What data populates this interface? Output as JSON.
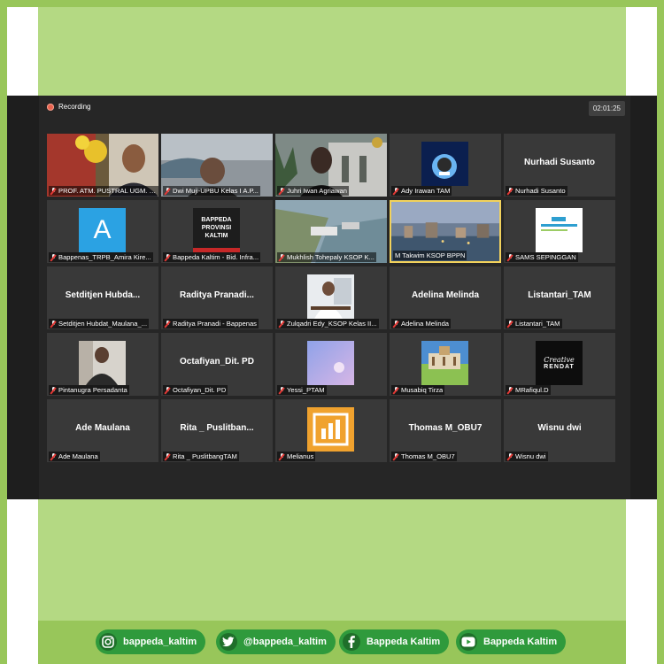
{
  "recording_label": "Recording",
  "timer": "02:01:25",
  "participants": [
    {
      "big_name": "",
      "label": "PROF. ATM. PUSTRAL UGM. M..."
    },
    {
      "big_name": "",
      "label": "Dwi Muji-UPBU Kelas I A.P..."
    },
    {
      "big_name": "",
      "label": "Juhri Iwan Agriawan"
    },
    {
      "big_name": "",
      "label": "Ady Irawan TAM"
    },
    {
      "big_name": "Nurhadi Susanto",
      "label": "Nurhadi Susanto"
    },
    {
      "big_name": "",
      "label": "Bappenas_TRPB_Amira Kire..."
    },
    {
      "big_name": "",
      "label": "Bappeda Kaltim - Bid. Infra..."
    },
    {
      "big_name": "",
      "label": "Mukhlish Tohepaly KSOP K..."
    },
    {
      "big_name": "",
      "label": "M Takwim KSOP BPPN"
    },
    {
      "big_name": "",
      "label": "SAMS SEPINGGAN"
    },
    {
      "big_name": "Setditjen  Hubda...",
      "label": "Setditjen Hubdat_Maulana_..."
    },
    {
      "big_name": "Raditya  Pranadi...",
      "label": "Raditya Pranadi - Bappenas"
    },
    {
      "big_name": "",
      "label": "Zulqadri Edy_KSOP Kelas II..."
    },
    {
      "big_name": "Adelina Melinda",
      "label": "Adelina Melinda"
    },
    {
      "big_name": "Listantari_TAM",
      "label": "Listantari_TAM"
    },
    {
      "big_name": "",
      "label": "Pintanugra Persadanta"
    },
    {
      "big_name": "Octafiyan_Dit. PD",
      "label": "Octafiyan_Dit. PD"
    },
    {
      "big_name": "",
      "label": "Yessi_PTAM"
    },
    {
      "big_name": "",
      "label": "Musabiq Tirza"
    },
    {
      "big_name": "",
      "label": "MRafiqul.D"
    },
    {
      "big_name": "Ade Maulana",
      "label": "Ade Maulana"
    },
    {
      "big_name": "Rita _ Puslitban...",
      "label": "Rita _ PuslitbangTAM"
    },
    {
      "big_name": "",
      "label": "Melianus"
    },
    {
      "big_name": "Thomas M_OBU7",
      "label": "Thomas M_OBU7"
    },
    {
      "big_name": "Wisnu dwi",
      "label": "Wisnu dwi"
    }
  ],
  "avatar_texts": {
    "letter_a": "A",
    "bappeda_logo": "BAPPEDA PROVINSI KALTIM",
    "creative_line1": "Creative",
    "creative_line2": "RENDAT"
  },
  "social": {
    "instagram": "bappeda_kaltim",
    "twitter": "@bappeda_kaltim",
    "facebook": "Bappeda Kaltim",
    "youtube": "Bappeda Kaltim"
  }
}
